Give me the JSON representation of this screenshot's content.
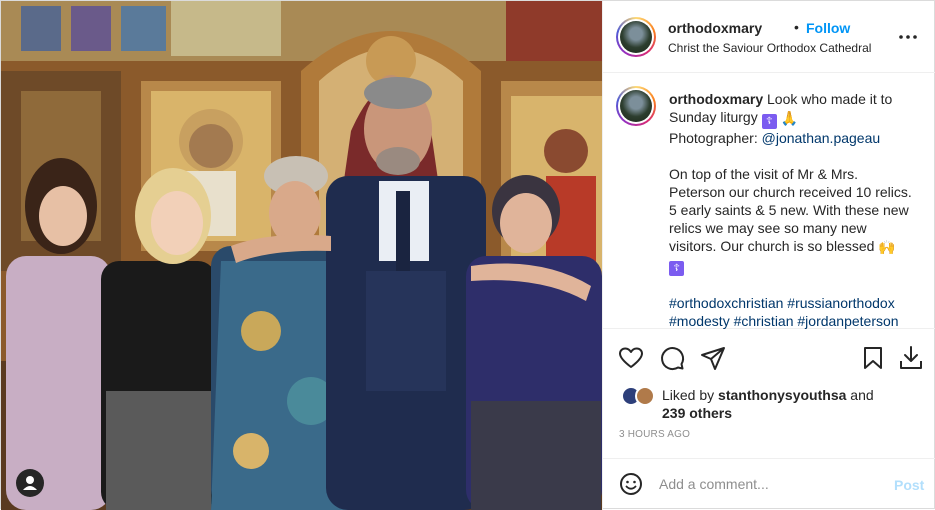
{
  "post": {
    "username": "orthodoxmary",
    "dot": "•",
    "follow_label": "Follow",
    "location": "Christ the Saviour Orthodox Cathedral"
  },
  "caption": {
    "username": "orthodoxmary",
    "line1": "Look who made it to",
    "line2": "Sunday liturgy",
    "badge_glyph": "☦",
    "emoji_pray": "🙏",
    "photographer_label": "Photographer:",
    "photographer_handle": "@jonathan.pageau",
    "para_lines": [
      "On top of the visit of Mr & Mrs.",
      "Peterson our church received 10 relics.",
      "5 early saints & 5 new. With these new",
      "relics we may see so many new",
      "visitors. Our church is so blessed"
    ],
    "emoji_blessed": "🙌",
    "hashtag_line1": "#orthodoxchristian #russianorthodox",
    "hashtag_line2": "#modesty #christian #jordanpeterson"
  },
  "actions": {
    "like": "heart-icon",
    "comment": "comment-icon",
    "share": "share-icon",
    "save": "bookmark-icon",
    "download": "download-icon"
  },
  "likes": {
    "prefix": "Liked by",
    "user": "stanthonysyouthsa",
    "and": "and",
    "others": "239 others"
  },
  "timestamp": "3 HOURS AGO",
  "comment_box": {
    "placeholder": "Add a comment...",
    "post_label": "Post"
  },
  "colors": {
    "accent": "#0095f6",
    "link": "#00376b",
    "post_disabled": "#b2dffc",
    "muted": "#8e8e8e"
  }
}
